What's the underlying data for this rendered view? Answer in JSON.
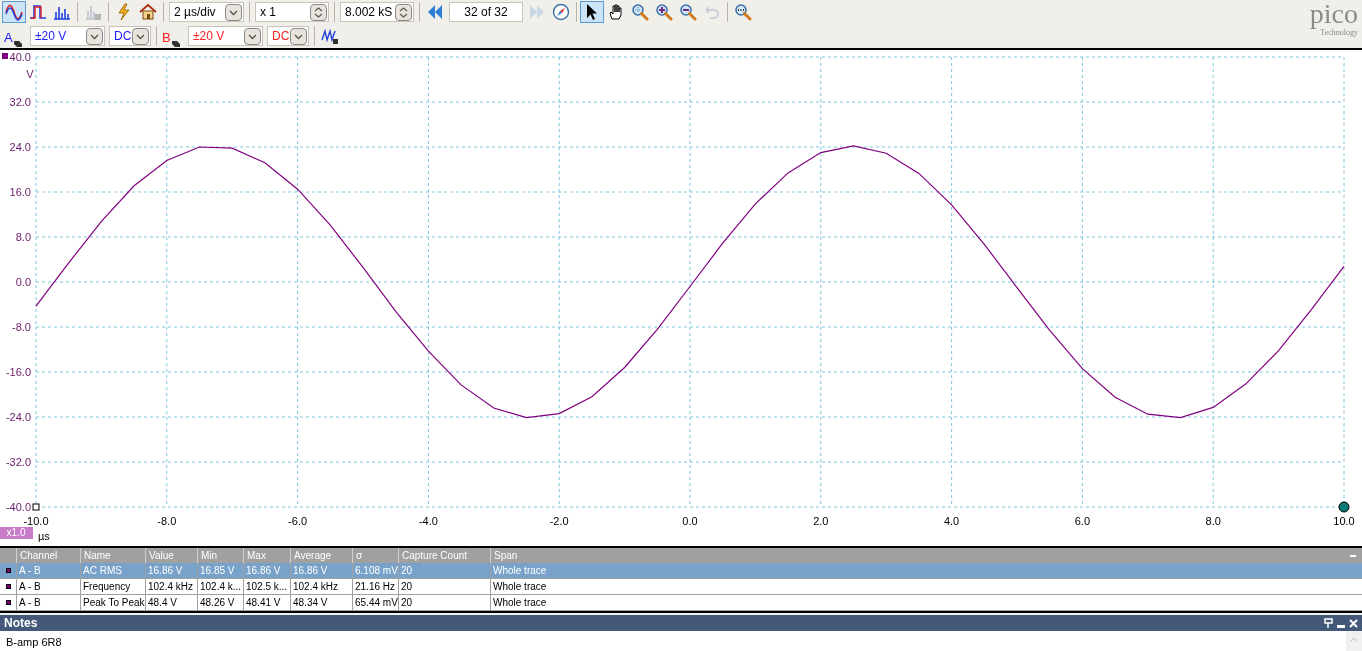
{
  "toolbar": {
    "rows": [
      [
        {
          "kind": "button",
          "selected": true,
          "disabled": false
        },
        {
          "kind": "button",
          "selected": false,
          "disabled": false
        },
        {
          "kind": "button",
          "selected": false,
          "disabled": false
        },
        {
          "kind": "separator"
        },
        {
          "kind": "button",
          "selected": false,
          "disabled": true
        },
        {
          "kind": "separator"
        },
        {
          "kind": "button",
          "selected": false,
          "disabled": false
        },
        {
          "kind": "button",
          "selected": false,
          "disabled": false
        },
        {
          "kind": "separator"
        },
        {
          "kind": "dropdown",
          "value": "2 µs/div"
        },
        {
          "kind": "separator"
        },
        {
          "kind": "spinner",
          "value": "x 1"
        },
        {
          "kind": "separator"
        },
        {
          "kind": "spinner",
          "value": "8.002 kS"
        },
        {
          "kind": "separator"
        },
        {
          "kind": "button",
          "selected": false,
          "disabled": false
        },
        {
          "kind": "field",
          "value": "32 of 32"
        },
        {
          "kind": "button",
          "selected": false,
          "disabled": true
        },
        {
          "kind": "button",
          "selected": false,
          "disabled": false
        },
        {
          "kind": "separator"
        },
        {
          "kind": "button",
          "selected": true,
          "disabled": false
        },
        {
          "kind": "button",
          "selected": false,
          "disabled": false
        },
        {
          "kind": "button",
          "selected": false,
          "disabled": false
        },
        {
          "kind": "button",
          "selected": false,
          "disabled": false
        },
        {
          "kind": "button",
          "selected": false,
          "disabled": false
        },
        {
          "kind": "button",
          "selected": false,
          "disabled": true
        },
        {
          "kind": "separator"
        },
        {
          "kind": "button",
          "selected": false,
          "disabled": false
        }
      ],
      [
        {
          "kind": "channel",
          "label": "A",
          "color": "#1a1aff"
        },
        {
          "kind": "dropdown",
          "value": "±20 V",
          "color": "#1a1aff"
        },
        {
          "kind": "dropdown",
          "value": "DC",
          "color": "#1a1aff"
        },
        {
          "kind": "separator"
        },
        {
          "kind": "channel",
          "label": "B",
          "color": "#ff2020"
        },
        {
          "kind": "dropdown",
          "value": "±20 V",
          "color": "#ff2020"
        },
        {
          "kind": "dropdown",
          "value": "DC",
          "color": "#ff2020"
        },
        {
          "kind": "separator"
        },
        {
          "kind": "button",
          "selected": false,
          "disabled": false
        }
      ]
    ]
  },
  "logo": {
    "name": "pico",
    "tagline": "Technology"
  },
  "chart": {
    "unit_badge": "x1.0",
    "chart_data": {
      "type": "line",
      "grid": true,
      "xlabel": "µs",
      "ylabel": "V",
      "xlim": [
        -10,
        10
      ],
      "ylim": [
        -40,
        40
      ],
      "xticks": [
        {
          "value": -10,
          "label": "-10.0"
        },
        {
          "value": -8,
          "label": "-8.0"
        },
        {
          "value": -6,
          "label": "-6.0"
        },
        {
          "value": -4,
          "label": "-4.0"
        },
        {
          "value": -2,
          "label": "-2.0"
        },
        {
          "value": 0,
          "label": "0.0"
        },
        {
          "value": 2,
          "label": "2.0"
        },
        {
          "value": 4,
          "label": "4.0"
        },
        {
          "value": 6,
          "label": "6.0"
        },
        {
          "value": 8,
          "label": "8.0"
        },
        {
          "value": 10,
          "label": "10.0"
        }
      ],
      "yticks": [
        {
          "value": 40,
          "label": "40.0"
        },
        {
          "value": 32,
          "label": "32.0"
        },
        {
          "value": 24,
          "label": "24.0"
        },
        {
          "value": 16,
          "label": "16.0"
        },
        {
          "value": 8,
          "label": "8.0"
        },
        {
          "value": 0,
          "label": "0.0"
        },
        {
          "value": -8,
          "label": "-8.0"
        },
        {
          "value": -16,
          "label": "-16.0"
        },
        {
          "value": -24,
          "label": "-24.0"
        },
        {
          "value": -32,
          "label": "-32.0"
        },
        {
          "value": -40,
          "label": "-40.0"
        }
      ],
      "x": [
        -10,
        -9.5,
        -9,
        -8.5,
        -8,
        -7.5,
        -7,
        -6.5,
        -6,
        -5.5,
        -5,
        -4.5,
        -4,
        -3.5,
        -3,
        -2.5,
        -2,
        -1.5,
        -1,
        -0.5,
        0,
        0.5,
        1,
        1.5,
        2,
        2.5,
        3,
        3.5,
        4,
        4.5,
        5,
        5.5,
        6,
        6.5,
        7,
        7.5,
        8,
        8.5,
        9,
        9.5,
        10
      ],
      "series": [
        {
          "color": "#800080",
          "values": [
            -4.3,
            3.4,
            10.8,
            17.1,
            21.6,
            24.0,
            23.8,
            21.2,
            16.5,
            10.1,
            2.6,
            -5.2,
            -12.3,
            -18.3,
            -22.4,
            -24.1,
            -23.4,
            -20.4,
            -15.2,
            -8.4,
            -0.8,
            6.9,
            13.9,
            19.4,
            23.0,
            24.2,
            22.9,
            19.3,
            13.7,
            6.7,
            -1.0,
            -8.6,
            -15.4,
            -20.5,
            -23.5,
            -24.1,
            -22.3,
            -18.1,
            -12.2,
            -4.9,
            2.8
          ]
        }
      ]
    }
  },
  "measurements": {
    "columns": [
      "Channel",
      "Name",
      "Value",
      "Min",
      "Max",
      "Average",
      "σ",
      "Capture Count",
      "Span"
    ],
    "rows": [
      {
        "selected": true,
        "cells": [
          "A - B",
          "AC RMS",
          "16.86 V",
          "16.85 V",
          "16.86 V",
          "16.86 V",
          "6.108 mV",
          "20",
          "Whole trace"
        ]
      },
      {
        "selected": false,
        "cells": [
          "A - B",
          "Frequency",
          "102.4 kHz",
          "102.4 k...",
          "102.5 k...",
          "102.4 kHz",
          "21.16 Hz",
          "20",
          "Whole trace"
        ]
      },
      {
        "selected": false,
        "cells": [
          "A - B",
          "Peak To Peak",
          "48.4 V",
          "48.26 V",
          "48.41 V",
          "48.34 V",
          "65.44 mV",
          "20",
          "Whole trace"
        ]
      }
    ]
  },
  "notes": {
    "title": "Notes",
    "text": "B-amp 6R8"
  }
}
